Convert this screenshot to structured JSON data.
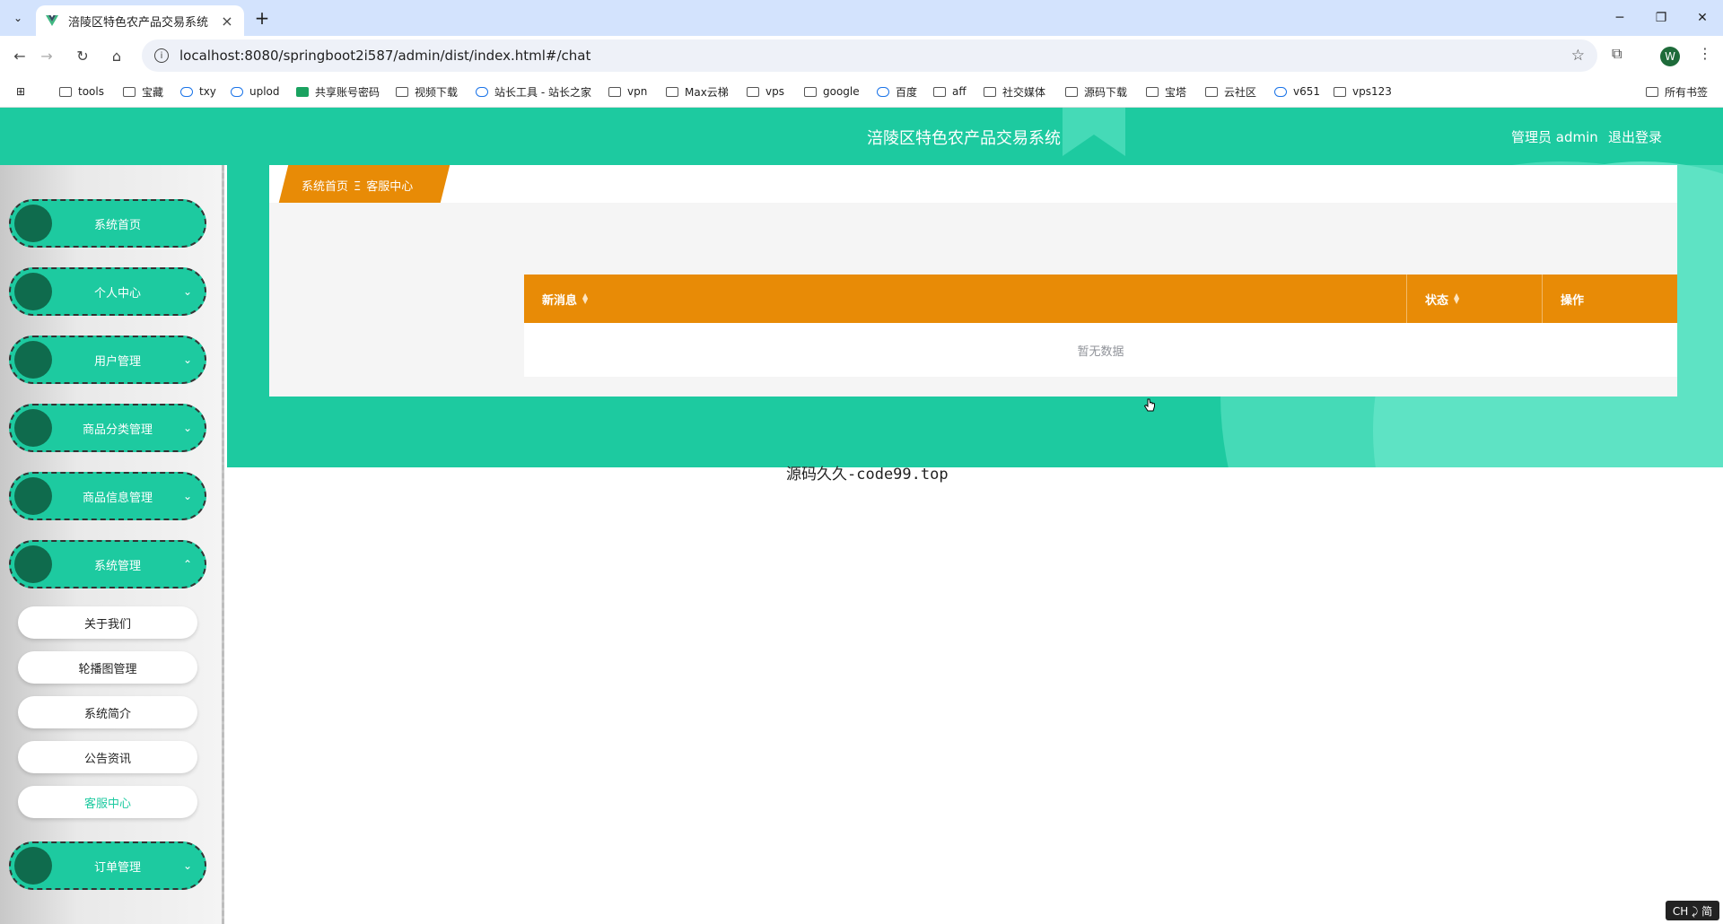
{
  "browser": {
    "tab_title": "涪陵区特色农产品交易系统",
    "url": "localhost:8080/springboot2i587/admin/dist/index.html#/chat",
    "bookmarks": [
      "tools",
      "宝藏",
      "txy",
      "uplod",
      "共享账号密码",
      "视频下载",
      "站长工具 - 站长之家",
      "vpn",
      "Max云梯",
      "vps",
      "google",
      "百度",
      "aff",
      "社交媒体",
      "源码下载",
      "宝塔",
      "云社区",
      "v651",
      "vps123"
    ],
    "bookmarks_all": "所有书签",
    "profile_initial": "W"
  },
  "header": {
    "title": "涪陵区特色农产品交易系统",
    "user": "管理员 admin",
    "logout": "退出登录"
  },
  "sidebar": {
    "items": [
      {
        "label": "系统首页"
      },
      {
        "label": "个人中心"
      },
      {
        "label": "用户管理"
      },
      {
        "label": "商品分类管理"
      },
      {
        "label": "商品信息管理"
      },
      {
        "label": "系统管理"
      },
      {
        "label": "订单管理"
      }
    ],
    "sub_items": [
      {
        "label": "关于我们"
      },
      {
        "label": "轮播图管理"
      },
      {
        "label": "系统简介"
      },
      {
        "label": "公告资讯"
      },
      {
        "label": "客服中心"
      }
    ]
  },
  "breadcrumb": {
    "home": "系统首页",
    "separator": "Ξ",
    "current": "客服中心"
  },
  "table": {
    "columns": [
      "新消息",
      "状态",
      "操作"
    ],
    "empty_text": "暂无数据"
  },
  "footer": {
    "text": "源码久久-code99.top"
  },
  "ime": "CH ⤸ 简",
  "colors": {
    "primary": "#1dcaa0",
    "accent": "#e88b06",
    "menu_dot": "#0f6b4d"
  }
}
